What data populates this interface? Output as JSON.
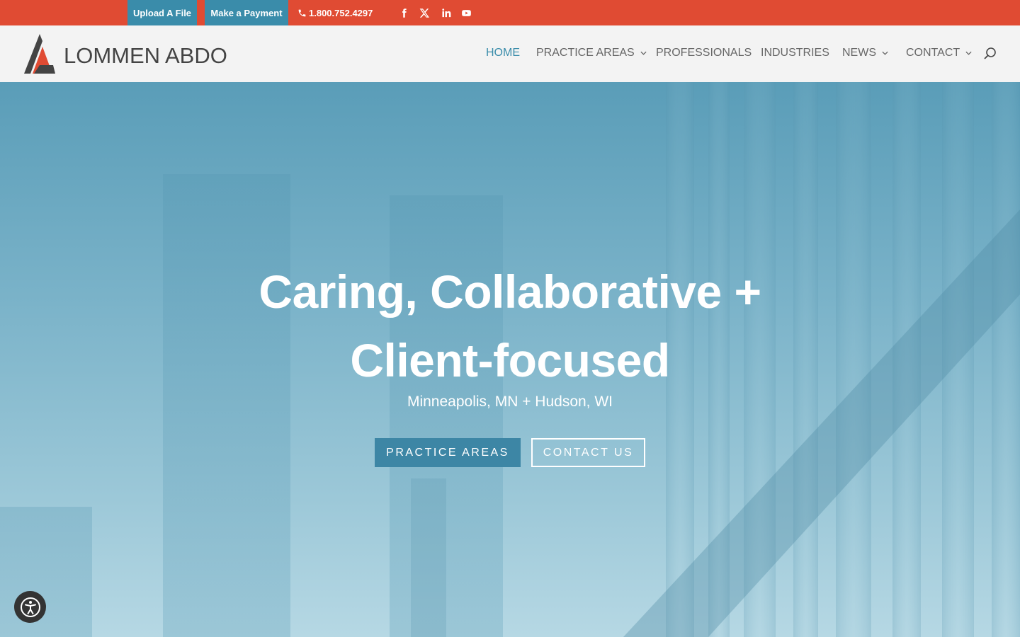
{
  "topbar": {
    "upload_label": "Upload A File",
    "payment_label": "Make a Payment",
    "phone": "1.800.752.4297",
    "social": [
      "facebook-icon",
      "x-icon",
      "linkedin-icon",
      "youtube-icon"
    ],
    "bg_color": "#e04b33",
    "button_color": "#3a8caa"
  },
  "header": {
    "logo_text": "LOMMEN ABDO",
    "nav": {
      "home": "HOME",
      "practice": "PRACTICE AREAS",
      "professionals": "PROFESSIONALS",
      "industries": "INDUSTRIES",
      "news": "NEWS",
      "contact": "CONTACT"
    },
    "active_color": "#3a8caa"
  },
  "hero": {
    "title_line1": "Caring, Collaborative +",
    "title_line2": "Client-focused",
    "subtitle": "Minneapolis, MN + Hudson, WI",
    "primary_button": "PRACTICE AREAS",
    "secondary_button": "CONTACT US"
  }
}
